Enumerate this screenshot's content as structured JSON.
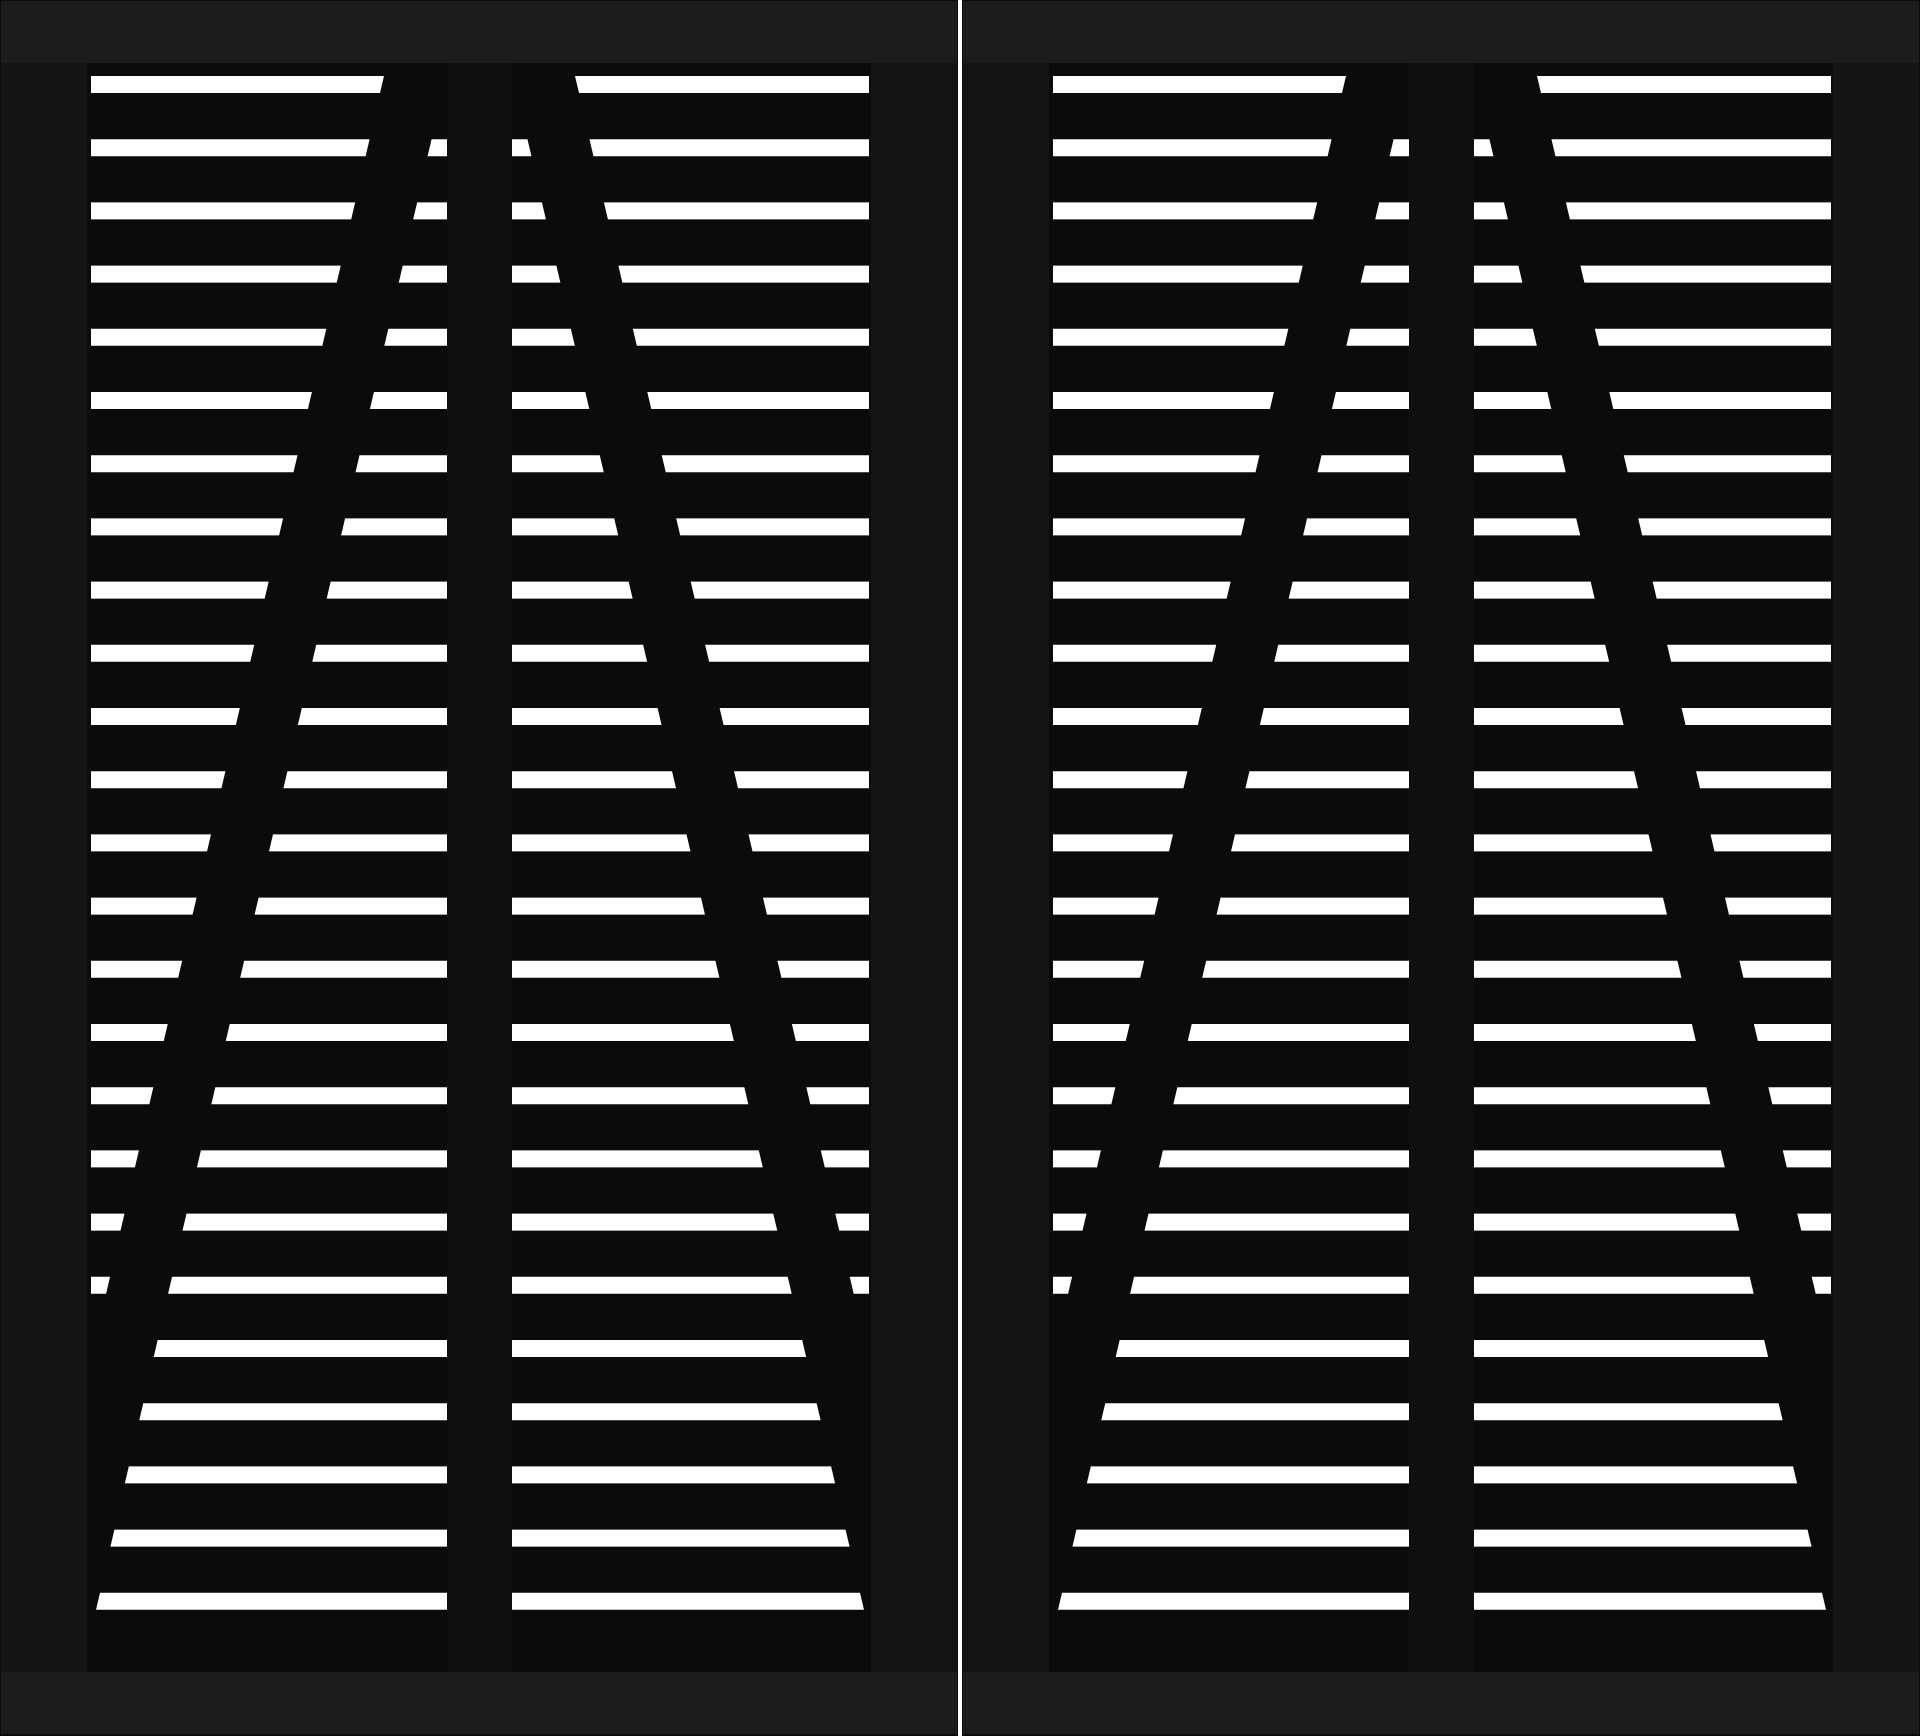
{
  "image": {
    "subject": "",
    "colors": {
      "background": "#ffffff",
      "frame": "#0b0b0b",
      "frame_edge": "#1c1c1c",
      "batten": "#0f0f0f",
      "opening": "#ffffff"
    },
    "panel_count": 2,
    "slat_rows_per_panel": 25
  }
}
